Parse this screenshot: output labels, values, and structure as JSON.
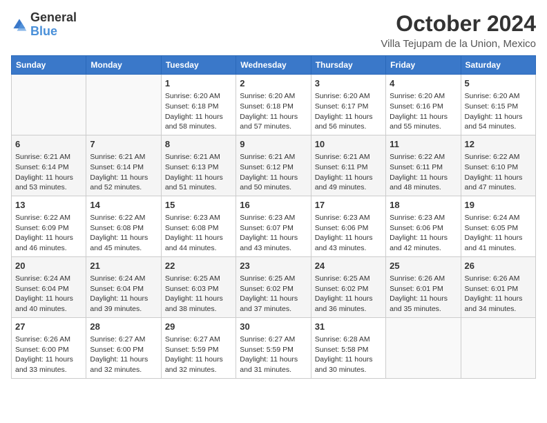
{
  "logo": {
    "general": "General",
    "blue": "Blue"
  },
  "header": {
    "month": "October 2024",
    "location": "Villa Tejupam de la Union, Mexico"
  },
  "days_of_week": [
    "Sunday",
    "Monday",
    "Tuesday",
    "Wednesday",
    "Thursday",
    "Friday",
    "Saturday"
  ],
  "weeks": [
    [
      {
        "day": "",
        "content": ""
      },
      {
        "day": "",
        "content": ""
      },
      {
        "day": "1",
        "content": "Sunrise: 6:20 AM\nSunset: 6:18 PM\nDaylight: 11 hours and 58 minutes."
      },
      {
        "day": "2",
        "content": "Sunrise: 6:20 AM\nSunset: 6:18 PM\nDaylight: 11 hours and 57 minutes."
      },
      {
        "day": "3",
        "content": "Sunrise: 6:20 AM\nSunset: 6:17 PM\nDaylight: 11 hours and 56 minutes."
      },
      {
        "day": "4",
        "content": "Sunrise: 6:20 AM\nSunset: 6:16 PM\nDaylight: 11 hours and 55 minutes."
      },
      {
        "day": "5",
        "content": "Sunrise: 6:20 AM\nSunset: 6:15 PM\nDaylight: 11 hours and 54 minutes."
      }
    ],
    [
      {
        "day": "6",
        "content": "Sunrise: 6:21 AM\nSunset: 6:14 PM\nDaylight: 11 hours and 53 minutes."
      },
      {
        "day": "7",
        "content": "Sunrise: 6:21 AM\nSunset: 6:14 PM\nDaylight: 11 hours and 52 minutes."
      },
      {
        "day": "8",
        "content": "Sunrise: 6:21 AM\nSunset: 6:13 PM\nDaylight: 11 hours and 51 minutes."
      },
      {
        "day": "9",
        "content": "Sunrise: 6:21 AM\nSunset: 6:12 PM\nDaylight: 11 hours and 50 minutes."
      },
      {
        "day": "10",
        "content": "Sunrise: 6:21 AM\nSunset: 6:11 PM\nDaylight: 11 hours and 49 minutes."
      },
      {
        "day": "11",
        "content": "Sunrise: 6:22 AM\nSunset: 6:11 PM\nDaylight: 11 hours and 48 minutes."
      },
      {
        "day": "12",
        "content": "Sunrise: 6:22 AM\nSunset: 6:10 PM\nDaylight: 11 hours and 47 minutes."
      }
    ],
    [
      {
        "day": "13",
        "content": "Sunrise: 6:22 AM\nSunset: 6:09 PM\nDaylight: 11 hours and 46 minutes."
      },
      {
        "day": "14",
        "content": "Sunrise: 6:22 AM\nSunset: 6:08 PM\nDaylight: 11 hours and 45 minutes."
      },
      {
        "day": "15",
        "content": "Sunrise: 6:23 AM\nSunset: 6:08 PM\nDaylight: 11 hours and 44 minutes."
      },
      {
        "day": "16",
        "content": "Sunrise: 6:23 AM\nSunset: 6:07 PM\nDaylight: 11 hours and 43 minutes."
      },
      {
        "day": "17",
        "content": "Sunrise: 6:23 AM\nSunset: 6:06 PM\nDaylight: 11 hours and 43 minutes."
      },
      {
        "day": "18",
        "content": "Sunrise: 6:23 AM\nSunset: 6:06 PM\nDaylight: 11 hours and 42 minutes."
      },
      {
        "day": "19",
        "content": "Sunrise: 6:24 AM\nSunset: 6:05 PM\nDaylight: 11 hours and 41 minutes."
      }
    ],
    [
      {
        "day": "20",
        "content": "Sunrise: 6:24 AM\nSunset: 6:04 PM\nDaylight: 11 hours and 40 minutes."
      },
      {
        "day": "21",
        "content": "Sunrise: 6:24 AM\nSunset: 6:04 PM\nDaylight: 11 hours and 39 minutes."
      },
      {
        "day": "22",
        "content": "Sunrise: 6:25 AM\nSunset: 6:03 PM\nDaylight: 11 hours and 38 minutes."
      },
      {
        "day": "23",
        "content": "Sunrise: 6:25 AM\nSunset: 6:02 PM\nDaylight: 11 hours and 37 minutes."
      },
      {
        "day": "24",
        "content": "Sunrise: 6:25 AM\nSunset: 6:02 PM\nDaylight: 11 hours and 36 minutes."
      },
      {
        "day": "25",
        "content": "Sunrise: 6:26 AM\nSunset: 6:01 PM\nDaylight: 11 hours and 35 minutes."
      },
      {
        "day": "26",
        "content": "Sunrise: 6:26 AM\nSunset: 6:01 PM\nDaylight: 11 hours and 34 minutes."
      }
    ],
    [
      {
        "day": "27",
        "content": "Sunrise: 6:26 AM\nSunset: 6:00 PM\nDaylight: 11 hours and 33 minutes."
      },
      {
        "day": "28",
        "content": "Sunrise: 6:27 AM\nSunset: 6:00 PM\nDaylight: 11 hours and 32 minutes."
      },
      {
        "day": "29",
        "content": "Sunrise: 6:27 AM\nSunset: 5:59 PM\nDaylight: 11 hours and 32 minutes."
      },
      {
        "day": "30",
        "content": "Sunrise: 6:27 AM\nSunset: 5:59 PM\nDaylight: 11 hours and 31 minutes."
      },
      {
        "day": "31",
        "content": "Sunrise: 6:28 AM\nSunset: 5:58 PM\nDaylight: 11 hours and 30 minutes."
      },
      {
        "day": "",
        "content": ""
      },
      {
        "day": "",
        "content": ""
      }
    ]
  ]
}
